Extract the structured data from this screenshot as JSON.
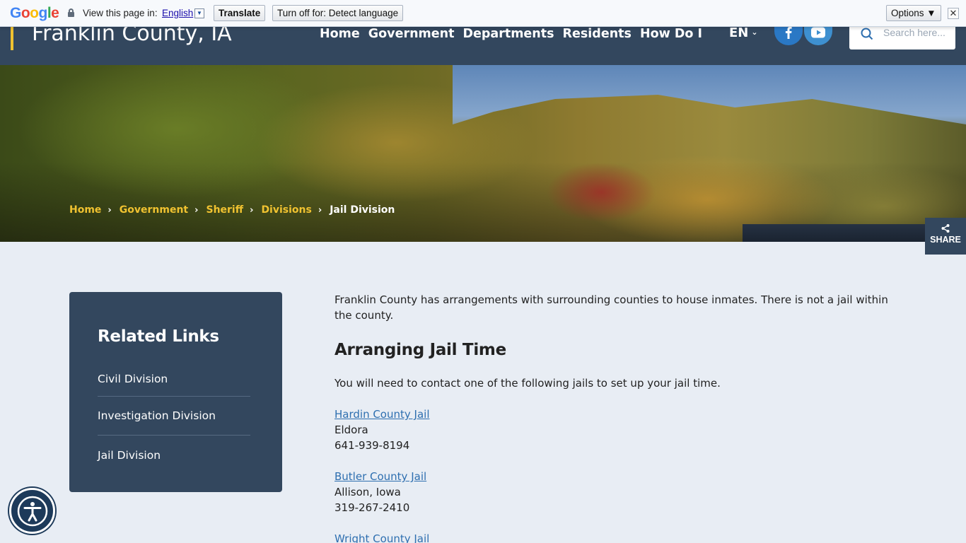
{
  "translate_bar": {
    "logo": [
      "G",
      "o",
      "o",
      "g",
      "l",
      "e"
    ],
    "view_text": "View this page in:",
    "language": "English",
    "translate_label": "Translate",
    "turn_off_label": "Turn off for: Detect language",
    "options_label": "Options ▼",
    "close_label": "✕"
  },
  "header": {
    "site_title": "Franklin County, IA",
    "nav": [
      "Home",
      "Government",
      "Departments",
      "Residents",
      "How Do I"
    ],
    "lang": "EN",
    "search_placeholder": "Search here..."
  },
  "breadcrumb": {
    "items": [
      "Home",
      "Government",
      "Sheriff",
      "Divisions"
    ],
    "current": "Jail Division"
  },
  "share_label": "SHARE",
  "sidebar": {
    "title": "Related Links",
    "links": [
      "Civil Division",
      "Investigation Division",
      "Jail Division"
    ]
  },
  "main": {
    "intro": "Franklin County has arrangements with surrounding counties to house inmates. There is not a jail within the county.",
    "heading": "Arranging Jail Time",
    "need_text": "You will need to contact one of the following jails to set up your jail time.",
    "jails": [
      {
        "name": "Hardin County Jail",
        "city": "Eldora",
        "phone": "641-939-8194"
      },
      {
        "name": "Butler County Jail",
        "city": "Allison, Iowa",
        "phone": "319-267-2410"
      },
      {
        "name": "Wright County Jail",
        "city": "",
        "phone": ""
      }
    ]
  },
  "colors": {
    "header_bg": "#33475e",
    "accent": "#f0c230",
    "link": "#2e6fb0",
    "page_bg": "#e8edf4"
  },
  "icons": {
    "search": "search-icon",
    "facebook": "facebook-icon",
    "youtube": "youtube-icon",
    "share": "share-icon",
    "accessibility": "accessibility-icon",
    "lock": "lock-icon"
  }
}
